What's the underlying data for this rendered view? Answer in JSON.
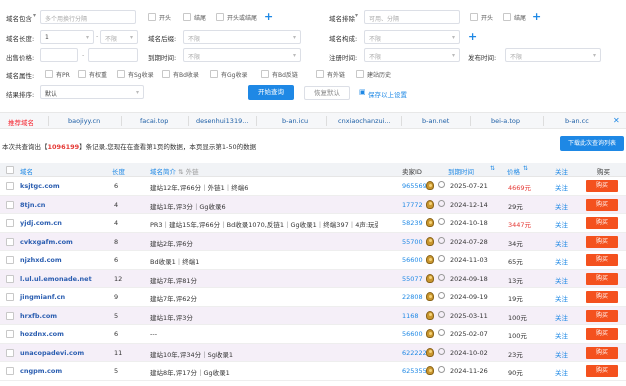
{
  "filters": {
    "row1": {
      "contains_label": "域名包含",
      "contains_placeholder": "多个用换行分隔",
      "cb_start": "开头",
      "cb_end": "结尾",
      "cb_start_or_end": "开头或结尾",
      "exclude_label": "域名排除",
      "exclude_placeholder": "可用、分隔",
      "cb_start2": "开头",
      "cb_end2": "结尾"
    },
    "row2": {
      "length_label": "域名长度:",
      "length_min": "1",
      "length_max": "不限",
      "suffix_label": "域名后缀:",
      "suffix_value": "不限",
      "compose_label": "域名构成:",
      "compose_value": "不限"
    },
    "row3": {
      "price_label": "出售价格:",
      "expire_label": "到期时间:",
      "expire_value": "不限",
      "register_label": "注册时间:",
      "register_value": "不限",
      "publish_label": "发布时间:",
      "publish_value": "不限"
    },
    "row4": {
      "attr_label": "域名属性:",
      "attrs": [
        "有PR",
        "有权重",
        "有Sg收录",
        "有Bd收录",
        "有Gg收录",
        "有Bd反链",
        "有外链",
        "建站历史"
      ]
    },
    "row5": {
      "sort_label": "结果排序:",
      "sort_value": "默认",
      "search_button": "开始查询",
      "restore_button": "恢复默认",
      "save_link": "保存以上设置"
    }
  },
  "tabs": [
    "推荐域名",
    "baojiyy.cn",
    "facai.top",
    "desenhui1319...",
    "b-an.icu",
    "cnxiaochanzui...",
    "b-an.net",
    "bei-a.top",
    "b-an.cc"
  ],
  "summary": {
    "prefix": "本次共查询出【",
    "count": "1096199",
    "suffix": "】条记录,您现在在查看第1页的数据，本页显示第1-50的数据",
    "download_button": "下载此次查询列表"
  },
  "columns": {
    "domain": "域名",
    "length": "长度",
    "brief": "域名简介",
    "brief_extra": "外链",
    "seller": "卖家ID",
    "expire": "到期时间",
    "price": "价格",
    "follow": "关注",
    "buy": "购买"
  },
  "rows": [
    {
      "domain": "ksjtgc.com",
      "length": "6",
      "brief": "建站12年,评66分｜外链1｜终端6",
      "seller": "965569",
      "expire": "2025-07-21",
      "price": "4669元",
      "price_red": true,
      "follow": "关注",
      "buy": "购买"
    },
    {
      "domain": "8tjn.cn",
      "length": "4",
      "brief": "建站1年,评3分｜Gg收录6",
      "seller": "17772",
      "expire": "2024-12-14",
      "price": "29元",
      "price_red": false,
      "follow": "关注",
      "buy": "购买"
    },
    {
      "domain": "yjdj.com.cn",
      "length": "4",
      "brief": "PR3｜建站15年,评66分｜Bd收录1070,反链1｜Gg收录1｜终端397｜4声:玩耍打...",
      "seller": "58239",
      "expire": "2024-10-18",
      "price": "3447元",
      "price_red": true,
      "follow": "关注",
      "buy": "购买"
    },
    {
      "domain": "cvkxgafm.com",
      "length": "8",
      "brief": "建站2年,评6分",
      "seller": "55700",
      "expire": "2024-07-28",
      "price": "34元",
      "price_red": false,
      "follow": "关注",
      "buy": "购买"
    },
    {
      "domain": "njzhxd.com",
      "length": "6",
      "brief": "Bd收录1｜终端1",
      "seller": "56600",
      "expire": "2024-11-03",
      "price": "65元",
      "price_red": false,
      "follow": "关注",
      "buy": "购买"
    },
    {
      "domain": "l.ul.ul.emonade.net",
      "length": "12",
      "brief": "建站7年,评81分",
      "seller": "55077",
      "expire": "2024-09-18",
      "price": "13元",
      "price_red": false,
      "follow": "关注",
      "buy": "购买"
    },
    {
      "domain": "jingmianf.cn",
      "length": "9",
      "brief": "建站7年,评62分",
      "seller": "22808",
      "expire": "2024-09-19",
      "price": "19元",
      "price_red": false,
      "follow": "关注",
      "buy": "购买"
    },
    {
      "domain": "hrxfb.com",
      "length": "5",
      "brief": "建站1年,评3分",
      "seller": "1168",
      "expire": "2025-03-11",
      "price": "100元",
      "price_red": false,
      "follow": "关注",
      "buy": "购买"
    },
    {
      "domain": "hozdnx.com",
      "length": "6",
      "brief": "---",
      "seller": "56600",
      "expire": "2025-02-07",
      "price": "100元",
      "price_red": false,
      "follow": "关注",
      "buy": "购买"
    },
    {
      "domain": "unacopadevi.com",
      "length": "11",
      "brief": "建站10年,评34分｜Sg收录1",
      "seller": "622222",
      "expire": "2024-10-02",
      "price": "23元",
      "price_red": false,
      "follow": "关注",
      "buy": "购买"
    },
    {
      "domain": "cngpm.com",
      "length": "5",
      "brief": "建站8年,评17分｜Gg收录1",
      "seller": "625355",
      "expire": "2024-11-26",
      "price": "90元",
      "price_red": false,
      "follow": "关注",
      "buy": "购买"
    }
  ]
}
